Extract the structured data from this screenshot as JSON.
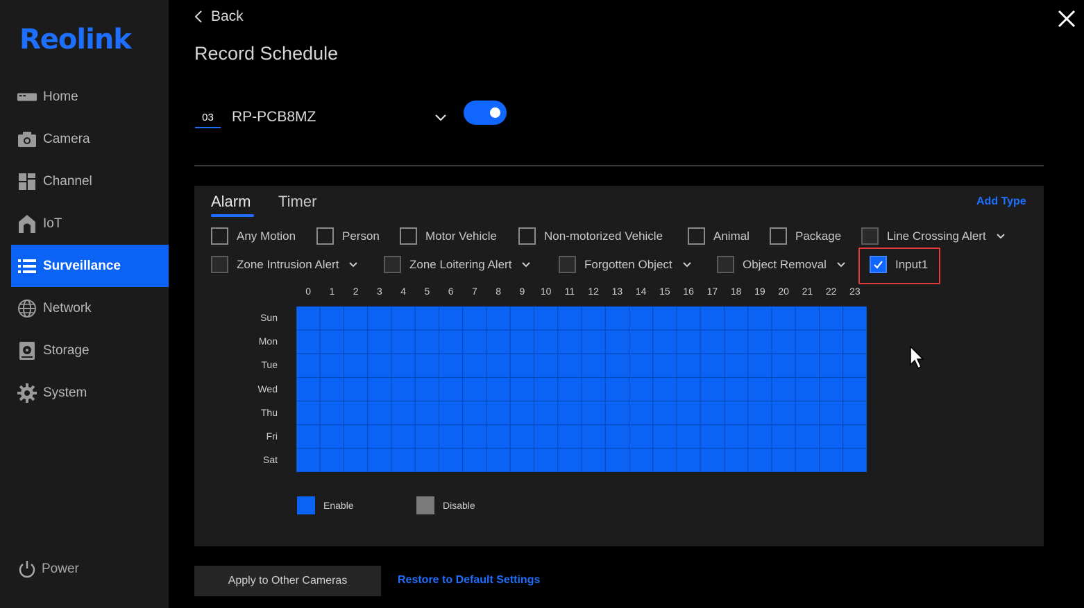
{
  "brand": {
    "logo": "Reolink",
    "accent": "#1f6fff"
  },
  "sidebar": {
    "items": [
      {
        "label": "Home",
        "icon": "home-icon"
      },
      {
        "label": "Camera",
        "icon": "camera-icon"
      },
      {
        "label": "Channel",
        "icon": "channel-icon"
      },
      {
        "label": "IoT",
        "icon": "iot-icon"
      },
      {
        "label": "Surveillance",
        "icon": "surveillance-icon",
        "active": true
      },
      {
        "label": "Network",
        "icon": "globe-icon"
      },
      {
        "label": "Storage",
        "icon": "storage-icon"
      },
      {
        "label": "System",
        "icon": "gear-icon"
      }
    ],
    "power": "Power"
  },
  "header": {
    "back": "Back",
    "title": "Record Schedule"
  },
  "channel": {
    "number": "03",
    "name": "RP-PCB8MZ",
    "enabled": true
  },
  "tabs": [
    {
      "label": "Alarm",
      "active": true
    },
    {
      "label": "Timer",
      "active": false
    }
  ],
  "add_type": "Add Type",
  "alarm_types_row1": [
    {
      "label": "Any Motion",
      "checked": false
    },
    {
      "label": "Person",
      "checked": false
    },
    {
      "label": "Motor Vehicle",
      "checked": false
    },
    {
      "label": "Non-motorized Vehicle",
      "checked": false
    },
    {
      "label": "Animal",
      "checked": false
    },
    {
      "label": "Package",
      "checked": false
    },
    {
      "label": "Line Crossing Alert",
      "checked": false,
      "dropdown": true,
      "disabled": true
    }
  ],
  "alarm_types_row2": [
    {
      "label": "Zone Intrusion Alert",
      "checked": false,
      "dropdown": true,
      "disabled": true
    },
    {
      "label": "Zone Loitering Alert",
      "checked": false,
      "dropdown": true,
      "disabled": true
    },
    {
      "label": "Forgotten Object",
      "checked": false,
      "dropdown": true,
      "disabled": true
    },
    {
      "label": "Object Removal",
      "checked": false,
      "dropdown": true,
      "disabled": true
    },
    {
      "label": "Input1",
      "checked": true,
      "highlighted": true
    }
  ],
  "schedule": {
    "hours": [
      "0",
      "1",
      "2",
      "3",
      "4",
      "5",
      "6",
      "7",
      "8",
      "9",
      "10",
      "11",
      "12",
      "13",
      "14",
      "15",
      "16",
      "17",
      "18",
      "19",
      "20",
      "21",
      "22",
      "23"
    ],
    "days": [
      "Sun",
      "Mon",
      "Tue",
      "Wed",
      "Thu",
      "Fri",
      "Sat"
    ],
    "all_enabled": true,
    "enable_color": "#0a63f4",
    "disable_color": "#7a7a7a"
  },
  "legend": {
    "enable": "Enable",
    "disable": "Disable"
  },
  "footer": {
    "apply": "Apply to Other Cameras",
    "restore": "Restore to Default Settings"
  }
}
